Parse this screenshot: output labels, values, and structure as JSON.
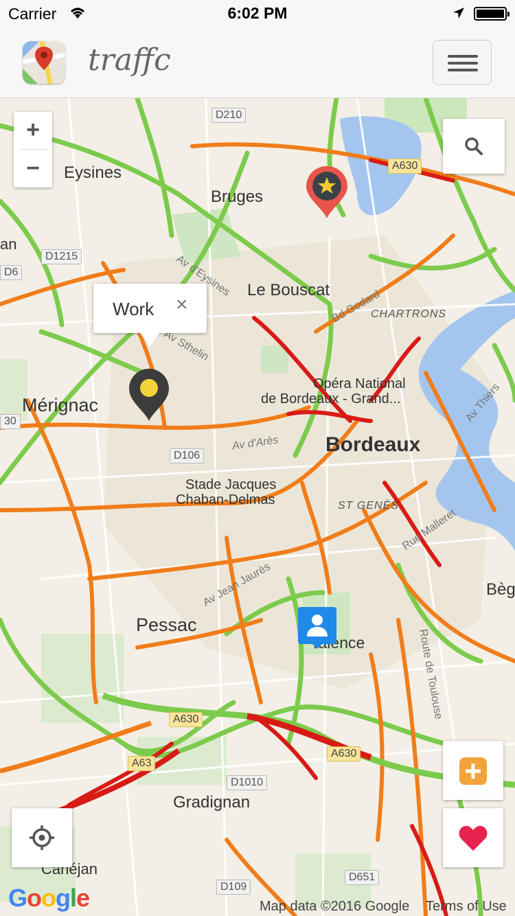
{
  "status_bar": {
    "carrier": "Carrier",
    "time": "6:02 PM"
  },
  "header": {
    "app_title": "traffc",
    "menu_icon": "hamburger-menu-icon"
  },
  "map": {
    "zoom_in": "+",
    "zoom_out": "−",
    "places": {
      "eysines": "Eysines",
      "bruges": "Bruges",
      "le_bouscat": "Le Bouscat",
      "chartrons": "CHARTRONS",
      "merignac": "Mérignac",
      "opera_1": "Opéra National",
      "opera_2": "de Bordeaux -  Grand...",
      "bordeaux": "Bordeaux",
      "stade_1": "Stade Jacques",
      "stade_2": "Chaban-Delmas",
      "st_genes": "ST GENÈS",
      "pessac": "Pessac",
      "talence": "Talence",
      "gradignan": "Gradignan",
      "canejan": "Canéjan",
      "begles": "Bèg",
      "an": "an"
    },
    "roads": {
      "d210": "D210",
      "d1215": "D1215",
      "d6": "D6",
      "d106": "D106",
      "a630_top": "A630",
      "a630_mid": "A630",
      "a630_right": "A630",
      "a63": "A63",
      "d1010": "D1010",
      "d109": "D109",
      "d651": "D651",
      "av_ares": "Av d'Arès",
      "av_jean_jaures": "Av Jean Jaurès",
      "rue_malleret": "Rue Malleret",
      "route_toulouse": "Route de Toulouse",
      "av_thiers": "Av Thiers",
      "bd_godard": "Bd Godard",
      "av_eysines": "Av d'Eysines",
      "av_sthelin": "Av Sthelin",
      "lbl_30": "30"
    },
    "info_window": {
      "title": "Work",
      "close": "×"
    },
    "markers": {
      "favorite": "star-marker-icon",
      "work": "work-pin-icon",
      "user": "user-location-icon"
    },
    "attribution": "Map data ©2016 Google",
    "terms": "Terms of Use",
    "google_logo": "Google"
  },
  "colors": {
    "traffic_green": "#7dcb4c",
    "traffic_orange": "#f07d1a",
    "traffic_red": "#d91b16",
    "water": "#a4c6ee",
    "favorite_marker": "#e8554a",
    "heart": "#e8234f",
    "add_button": "#f1a43c",
    "user_marker": "#1f8ae8"
  }
}
